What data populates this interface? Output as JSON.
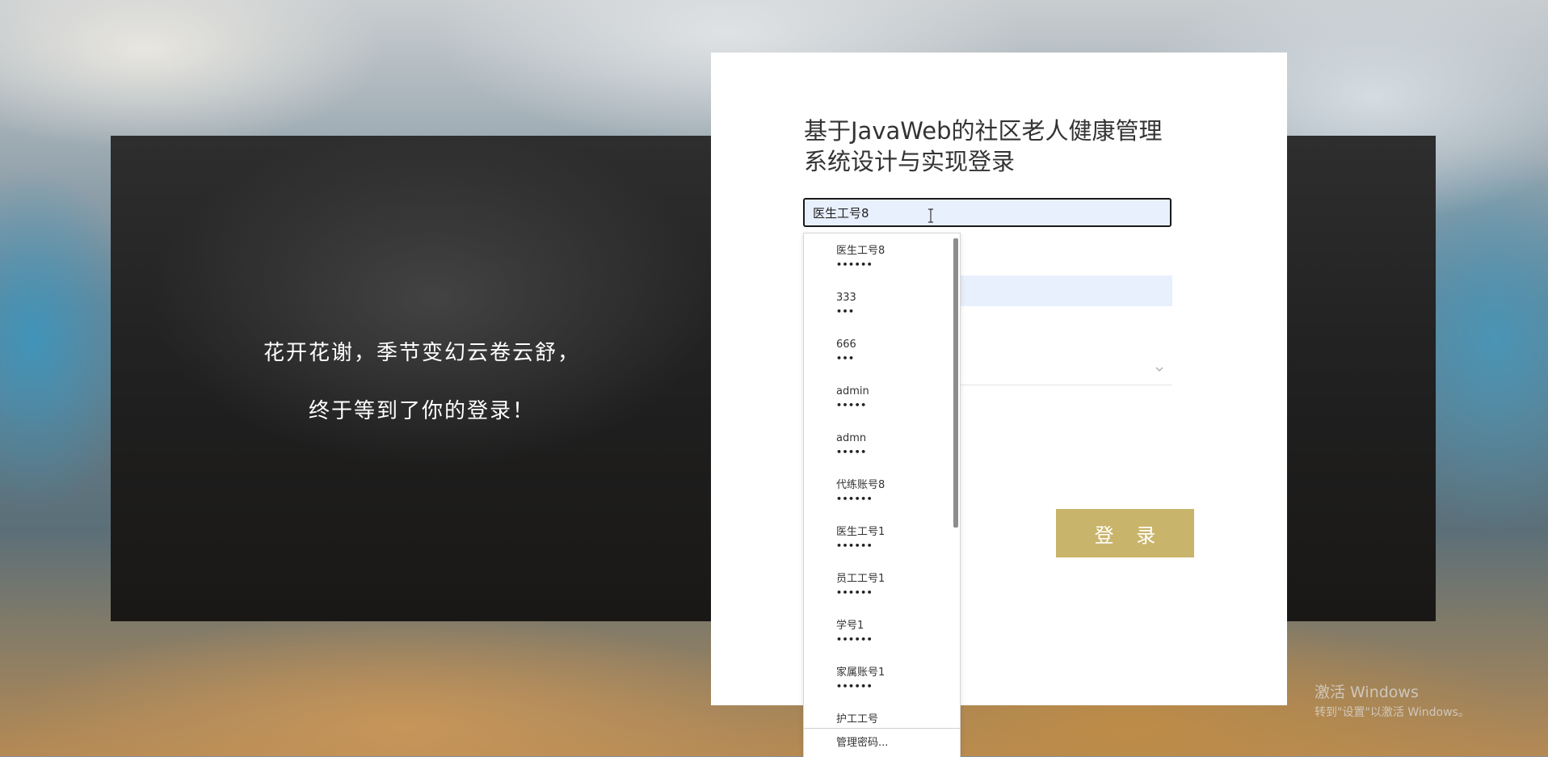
{
  "slogan": {
    "line1": "花开花谢，季节变幻云卷云舒，",
    "line2": "终于等到了你的登录！"
  },
  "form": {
    "title": "基于JavaWeb的社区老人健康管理系统设计与实现登录",
    "username_value": "医生工号8",
    "login_label": "登 录"
  },
  "autocomplete": {
    "items": [
      {
        "name": "医生工号8",
        "mask": "••••••"
      },
      {
        "name": "333",
        "mask": "•••"
      },
      {
        "name": "666",
        "mask": "•••"
      },
      {
        "name": "admin",
        "mask": "•••••"
      },
      {
        "name": "admn",
        "mask": "•••••"
      },
      {
        "name": "代练账号8",
        "mask": "••••••"
      },
      {
        "name": "医生工号1",
        "mask": "••••••"
      },
      {
        "name": "员工工号1",
        "mask": "••••••"
      },
      {
        "name": "学号1",
        "mask": "••••••"
      },
      {
        "name": "家属账号1",
        "mask": "••••••"
      },
      {
        "name": "护工工号",
        "mask": "••••••"
      }
    ],
    "footer": "管理密码..."
  },
  "watermark": {
    "line1": "激活 Windows",
    "line2": "转到\"设置\"以激活 Windows。"
  },
  "colors": {
    "button": "#c9b46b",
    "autofill": "#e8f0fe",
    "banner": "#262626"
  }
}
